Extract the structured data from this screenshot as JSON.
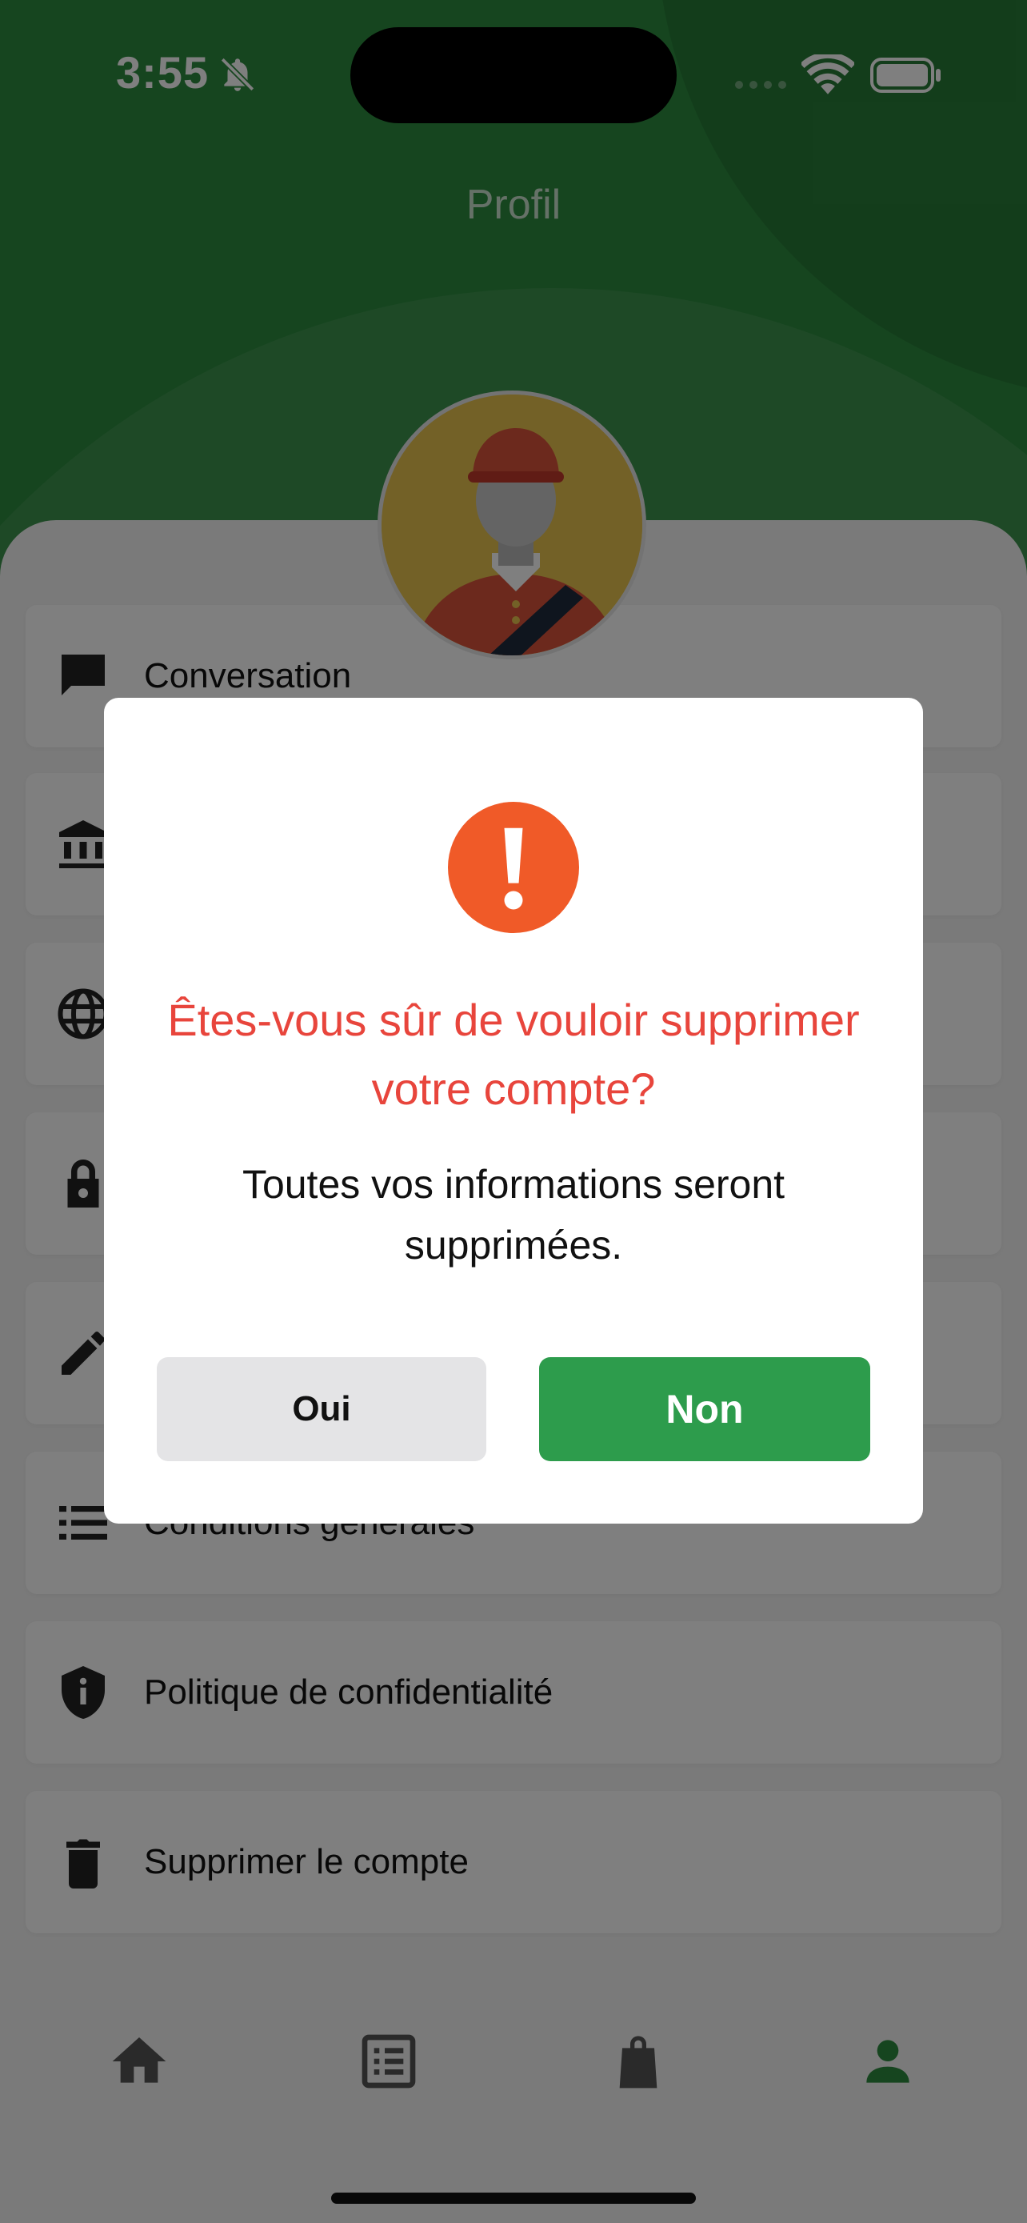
{
  "status_bar": {
    "time": "3:55"
  },
  "header": {
    "title": "Profil"
  },
  "menu": [
    {
      "label": "Conversation",
      "icon": "chat-icon"
    },
    {
      "label": "",
      "icon": "bank-icon"
    },
    {
      "label": "",
      "icon": "globe-icon"
    },
    {
      "label": "",
      "icon": "lock-icon"
    },
    {
      "label": "",
      "icon": "pencil-icon"
    },
    {
      "label": "Conditions générales",
      "icon": "list-icon"
    },
    {
      "label": "Politique de confidentialité",
      "icon": "shield-info-icon"
    },
    {
      "label": "Supprimer le compte",
      "icon": "trash-icon"
    }
  ],
  "dialog": {
    "title": "Êtes-vous sûr de vouloir supprimer votre compte?",
    "message": "Toutes vos informations seront supprimées.",
    "yes_label": "Oui",
    "no_label": "Non"
  },
  "bottom_nav": [
    {
      "icon": "home-icon",
      "active": false
    },
    {
      "icon": "orders-list-icon",
      "active": false
    },
    {
      "icon": "shopping-bag-icon",
      "active": false
    },
    {
      "icon": "profile-icon",
      "active": true
    }
  ],
  "colors": {
    "brand_green": "#2c8a3e",
    "confirm_green": "#2d9c4c",
    "alert_orange": "#f05a28",
    "title_red": "#e8453c",
    "nav_inactive": "#555555"
  }
}
